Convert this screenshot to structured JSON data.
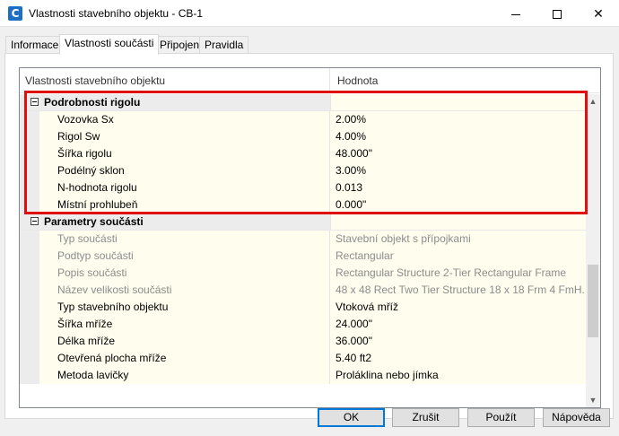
{
  "window": {
    "title": "Vlastnosti stavebního objektu - CB-1",
    "icon_glyph": "C",
    "controls": {
      "minimize": "minimize-icon",
      "maximize": "maximize-icon",
      "close": "✕"
    }
  },
  "tabs": [
    {
      "label": "Informace"
    },
    {
      "label": "Vlastnosti součásti",
      "active": true
    },
    {
      "label": "Připojení"
    },
    {
      "label": "Pravidla"
    }
  ],
  "grid": {
    "headers": {
      "name": "Vlastnosti stavebního objektu",
      "value": "Hodnota"
    },
    "groups": [
      {
        "name": "Podrobnosti rigolu",
        "highlighted": true,
        "rows": [
          {
            "name": "Vozovka Sx",
            "value": "2.00%",
            "readonly": false
          },
          {
            "name": "Rigol Sw",
            "value": "4.00%",
            "readonly": false
          },
          {
            "name": "Šířka rigolu",
            "value": "48.000\"",
            "readonly": false
          },
          {
            "name": "Podélný sklon",
            "value": "3.00%",
            "readonly": false
          },
          {
            "name": "N-hodnota rigolu",
            "value": "0.013",
            "readonly": false
          },
          {
            "name": "Místní prohlubeň",
            "value": "0.000\"",
            "readonly": false
          }
        ]
      },
      {
        "name": "Parametry součásti",
        "rows": [
          {
            "name": "Typ součásti",
            "value": "Stavební objekt s přípojkami",
            "readonly": true
          },
          {
            "name": "Podtyp součásti",
            "value": "Rectangular",
            "readonly": true
          },
          {
            "name": "Popis součásti",
            "value": "Rectangular Structure 2-Tier Rectangular Frame",
            "readonly": true
          },
          {
            "name": "Název velikosti součásti",
            "value": "48 x 48 Rect Two Tier Structure 18 x 18 Frm 4 FmH...",
            "readonly": true
          },
          {
            "name": "Typ stavebního objektu",
            "value": "Vtoková mříž",
            "readonly": false
          },
          {
            "name": "Šířka mříže",
            "value": "24.000\"",
            "readonly": false
          },
          {
            "name": "Délka mříže",
            "value": "36.000\"",
            "readonly": false
          },
          {
            "name": "Otevřená plocha mříže",
            "value": "5.40 ft2",
            "readonly": false
          },
          {
            "name": "Metoda lavičky",
            "value": "Proláklina nebo jímka",
            "readonly": false
          }
        ]
      }
    ],
    "highlight_color": "#e01010"
  },
  "buttons": {
    "ok": "OK",
    "cancel": "Zrušit",
    "apply": "Použít",
    "help": "Nápověda"
  }
}
